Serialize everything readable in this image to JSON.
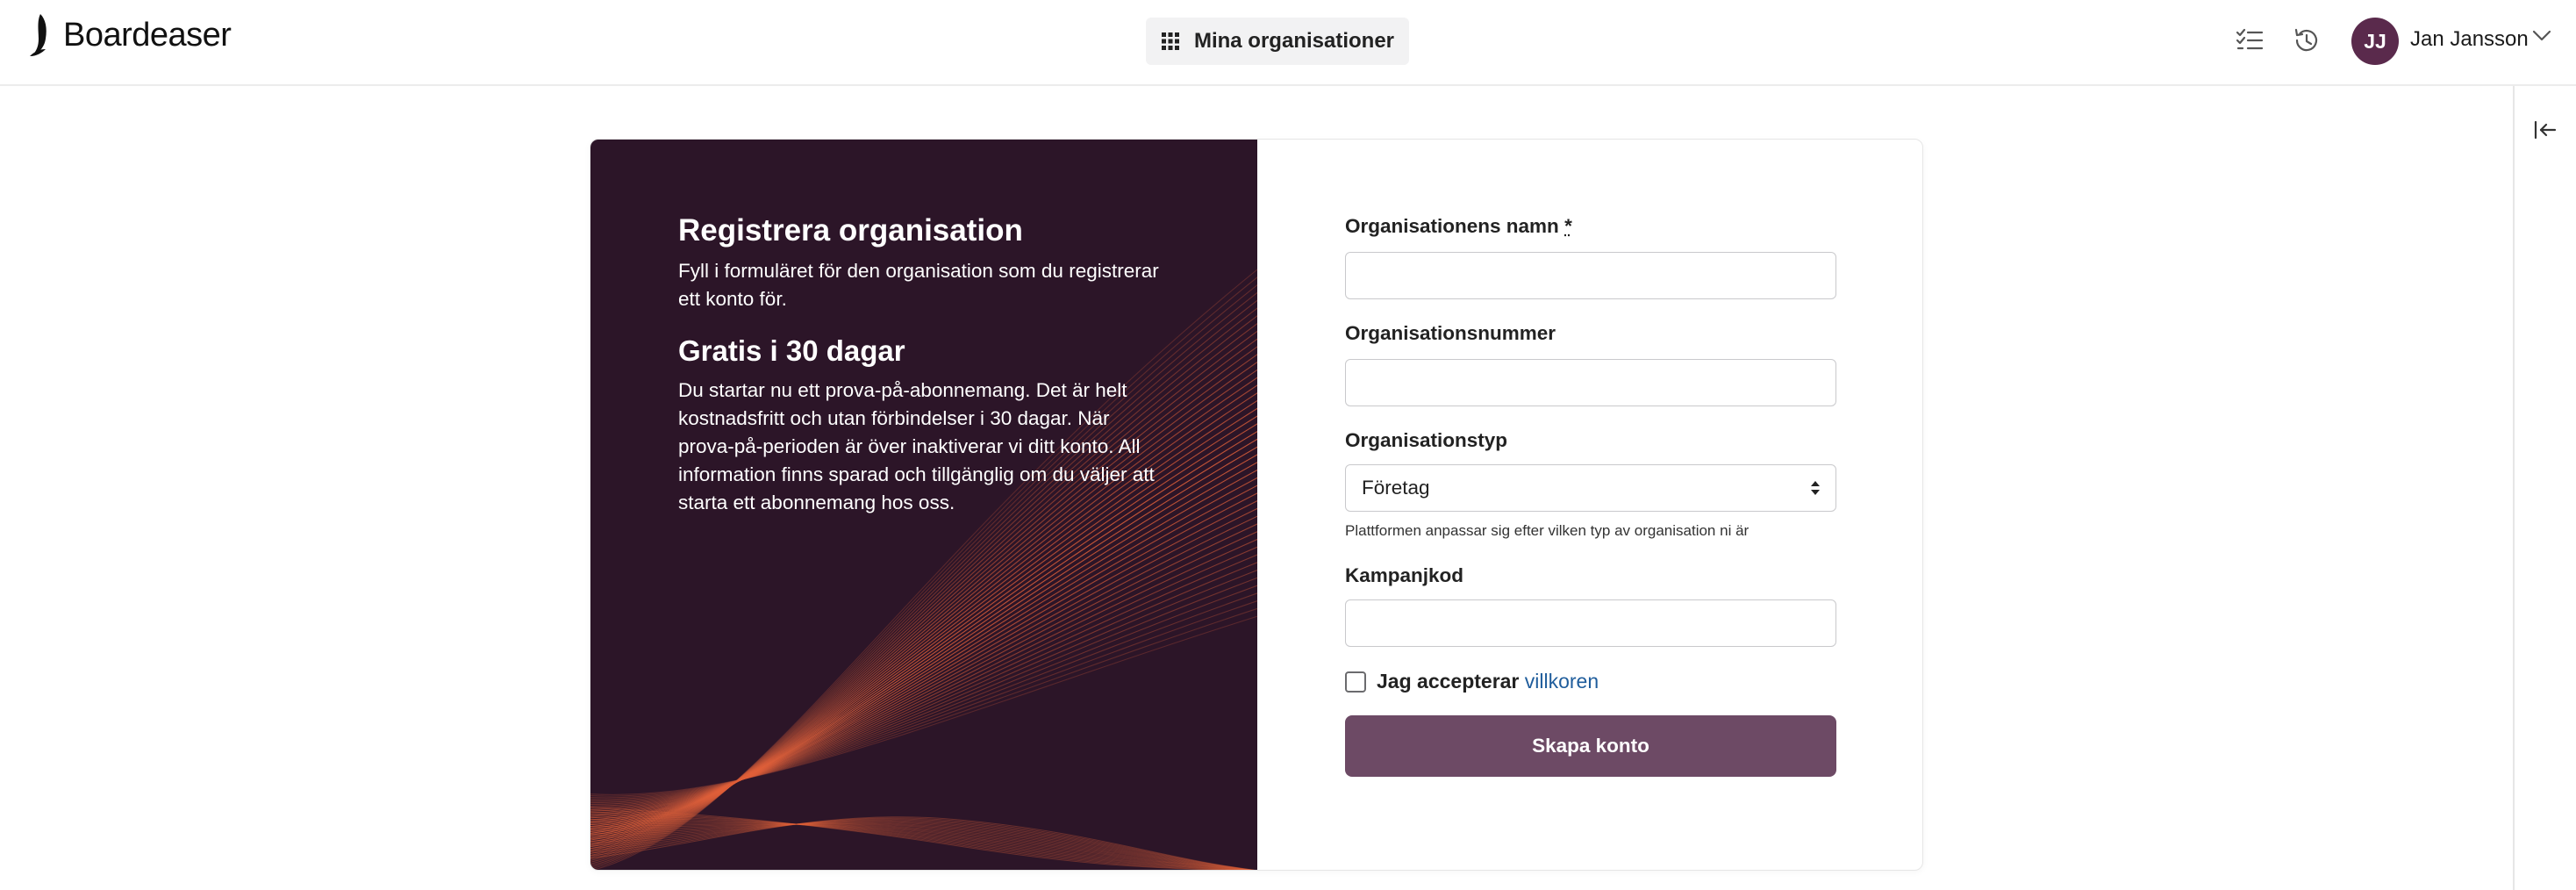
{
  "app": {
    "brand": "Boardeaser"
  },
  "header": {
    "org_button_label": "Mina organisationer",
    "user_initials": "JJ",
    "user_name": "Jan Jansson"
  },
  "intro": {
    "title": "Registrera organisation",
    "subtitle": "Fyll i formuläret för den organisation som du registrerar ett konto för.",
    "trial_title": "Gratis i 30 dagar",
    "trial_body": "Du startar nu ett prova-på-abonnemang. Det är helt kostnadsfritt och utan förbindelser i 30 dagar. När prova-på-perioden är över inaktiverar vi ditt konto. All information finns sparad och tillgänglig om du väljer att starta ett abonnemang hos oss."
  },
  "form": {
    "org_name_label": "Organisationens namn",
    "required_marker": "*",
    "org_name_value": "",
    "org_number_label": "Organisationsnummer",
    "org_number_value": "",
    "org_type_label": "Organisationstyp",
    "org_type_selected": "Företag",
    "org_type_hint": "Plattformen anpassar sig efter vilken typ av organisation ni är",
    "campaign_label": "Kampanjkod",
    "campaign_value": "",
    "accept_label": "Jag accepterar",
    "terms_link": "villkoren",
    "accept_checked": false,
    "submit_label": "Skapa konto"
  },
  "colors": {
    "accent": "#6d4a65",
    "panel_bg": "#2c1528",
    "avatar_bg": "#5a2a4c",
    "link": "#1f5d9c",
    "wave": "#e0603a"
  },
  "icons": {
    "org_button": "grid-icon",
    "tasks": "checklist-icon",
    "history": "history-icon",
    "user_menu": "chevron-down-icon",
    "side_panel": "collapse-panel-icon"
  }
}
